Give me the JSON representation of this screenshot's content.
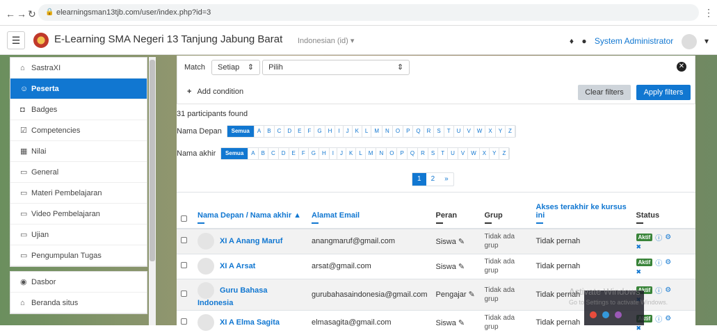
{
  "browser": {
    "url": "elearningsman13tjb.com/user/index.php?id=3"
  },
  "topbar": {
    "site_name": "E-Learning SMA Negeri 13 Tanjung Jabung Barat",
    "language": "Indonesian (id) ▾",
    "user_name": "System Administrator"
  },
  "sidebar": {
    "group1": [
      {
        "label": "SastraXI",
        "icon": "graduation-cap-icon",
        "glyph": "⌂"
      },
      {
        "label": "Peserta",
        "icon": "users-icon",
        "glyph": "☺",
        "active": true
      },
      {
        "label": "Badges",
        "icon": "shield-icon",
        "glyph": "◘"
      },
      {
        "label": "Competencies",
        "icon": "check-square-icon",
        "glyph": "☑"
      },
      {
        "label": "Nilai",
        "icon": "table-icon",
        "glyph": "▦"
      },
      {
        "label": "General",
        "icon": "folder-icon",
        "glyph": "▭"
      },
      {
        "label": "Materi Pembelajaran",
        "icon": "folder-icon",
        "glyph": "▭"
      },
      {
        "label": "Video Pembelajaran",
        "icon": "folder-icon",
        "glyph": "▭"
      },
      {
        "label": "Ujian",
        "icon": "folder-icon",
        "glyph": "▭"
      },
      {
        "label": "Pengumpulan Tugas",
        "icon": "folder-icon",
        "glyph": "▭"
      }
    ],
    "group2": [
      {
        "label": "Dasbor",
        "icon": "dashboard-icon",
        "glyph": "◉"
      },
      {
        "label": "Beranda situs",
        "icon": "home-icon",
        "glyph": "⌂"
      }
    ]
  },
  "filters": {
    "match_label": "Match",
    "match_value": "Setiap",
    "filter_placeholder": "Pilih",
    "add_condition": "Add condition",
    "clear_label": "Clear filters",
    "apply_label": "Apply filters"
  },
  "summary": "31 participants found",
  "initials": {
    "first_label": "Nama Depan",
    "last_label": "Nama akhir",
    "all_label": "Semua",
    "letters": [
      "A",
      "B",
      "C",
      "D",
      "E",
      "F",
      "G",
      "H",
      "I",
      "J",
      "K",
      "L",
      "M",
      "N",
      "O",
      "P",
      "Q",
      "R",
      "S",
      "T",
      "U",
      "V",
      "W",
      "X",
      "Y",
      "Z"
    ]
  },
  "pagination": [
    "1",
    "2",
    "»"
  ],
  "table": {
    "headers": {
      "name": "Nama Depan / Nama akhir ▲",
      "email": "Alamat Email",
      "role": "Peran",
      "group": "Grup",
      "access": "Akses terakhir ke kursus ini",
      "status": "Status"
    },
    "rows": [
      {
        "name": "XI A Anang Maruf",
        "email": "anangmaruf@gmail.com",
        "role": "Siswa",
        "group": "Tidak ada grup",
        "access": "Tidak pernah",
        "status": "Aktif"
      },
      {
        "name": "XI A Arsat",
        "email": "arsat@gmail.com",
        "role": "Siswa",
        "group": "Tidak ada grup",
        "access": "Tidak pernah",
        "status": "Aktif"
      },
      {
        "name": "Guru Bahasa Indonesia",
        "email": "gurubahasaindonesia@gmail.com",
        "role": "Pengajar",
        "group": "Tidak ada grup",
        "access": "Tidak pernah",
        "status": "Aktif"
      },
      {
        "name": "XI A Elma Sagita",
        "email": "elmasagita@gmail.com",
        "role": "Siswa",
        "group": "Tidak ada grup",
        "access": "Tidak pernah",
        "status": "Aktif"
      }
    ]
  },
  "watermark": {
    "line1": "Activate Windows",
    "line2": "Go to Settings to activate Windows."
  },
  "colors": {
    "accent": "#1177d1",
    "active_badge": "#398439"
  }
}
